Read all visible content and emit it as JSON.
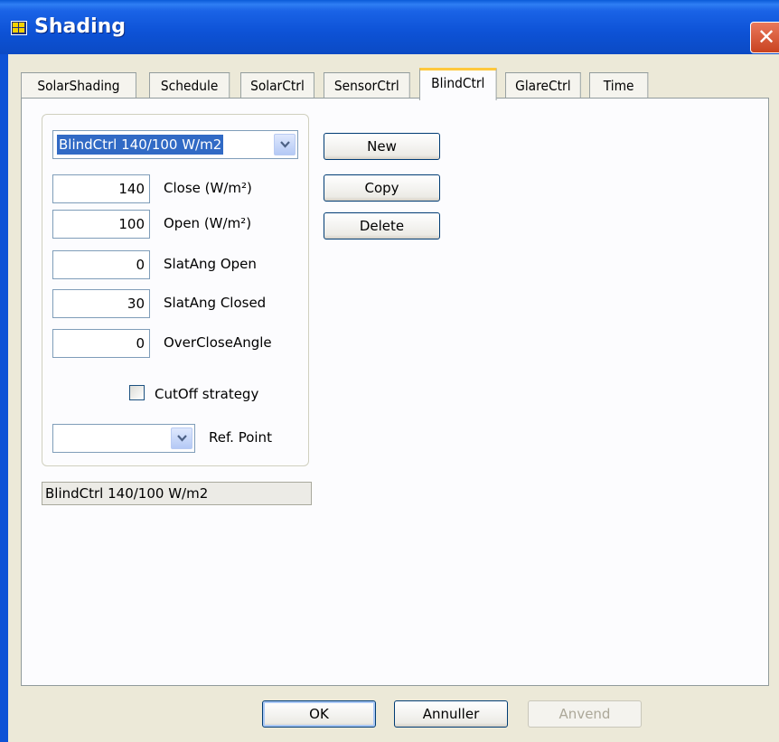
{
  "window": {
    "title": "Shading",
    "close_glyph": "✕"
  },
  "tabs": [
    {
      "label": "SolarShading"
    },
    {
      "label": "Schedule"
    },
    {
      "label": "SolarCtrl"
    },
    {
      "label": "SensorCtrl"
    },
    {
      "label": "BlindCtrl"
    },
    {
      "label": "GlareCtrl"
    },
    {
      "label": "Time"
    }
  ],
  "active_tab": "BlindCtrl",
  "blindctrl": {
    "selector_value": "BlindCtrl 140/100 W/m2",
    "close": {
      "value": "140",
      "label": "Close (W/m²)"
    },
    "open": {
      "value": "100",
      "label": "Open (W/m²)"
    },
    "slat_open": {
      "value": "0",
      "label": "SlatAng Open"
    },
    "slat_closed": {
      "value": "30",
      "label": "SlatAng Closed"
    },
    "overclose": {
      "value": "0",
      "label": "OverCloseAngle"
    },
    "cutoff": {
      "label": "CutOff strategy",
      "checked": false
    },
    "ref_point": {
      "value": "",
      "label": "Ref. Point"
    },
    "status_text": "BlindCtrl 140/100 W/m2"
  },
  "actions": {
    "new": "New",
    "copy": "Copy",
    "delete": "Delete"
  },
  "footer": {
    "ok": "OK",
    "cancel": "Annuller",
    "apply": "Anvend"
  },
  "colors": {
    "title_bar": "#0d52d6",
    "active_tab_accent": "#ffc83c",
    "selection": "#316ac5"
  }
}
